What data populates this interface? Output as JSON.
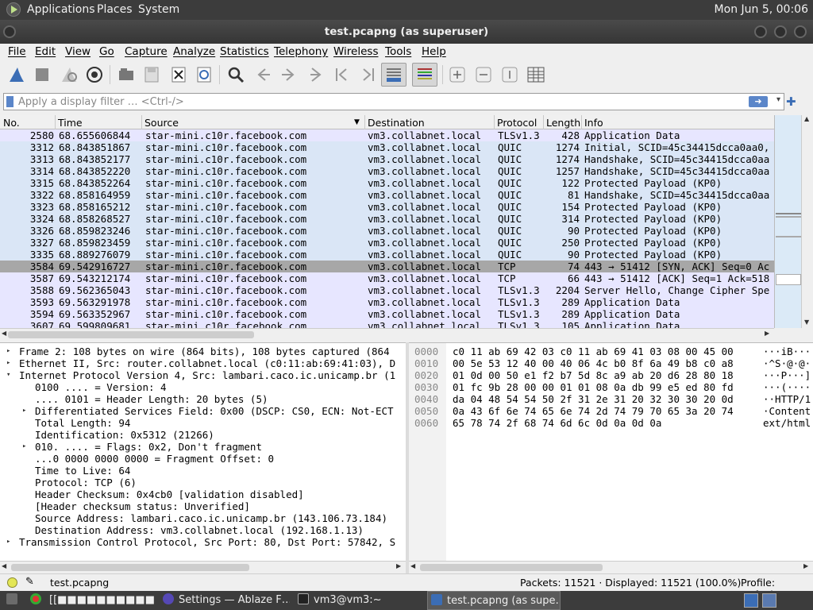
{
  "top_panel": {
    "menus": [
      "Applications",
      "Places",
      "System"
    ],
    "clock": "Mon Jun  5, 00:06"
  },
  "window": {
    "title": "test.pcapng (as superuser)"
  },
  "menubar": [
    "File",
    "Edit",
    "View",
    "Go",
    "Capture",
    "Analyze",
    "Statistics",
    "Telephony",
    "Wireless",
    "Tools",
    "Help"
  ],
  "filter": {
    "placeholder": "Apply a display filter … <Ctrl-/>"
  },
  "packet_list": {
    "columns": [
      "No.",
      "Time",
      "Source",
      "Destination",
      "Protocol",
      "Length",
      "Info"
    ],
    "rows": [
      [
        "2580",
        "68.655606844",
        "star-mini.c10r.facebook.com",
        "vm3.collabnet.local",
        "TLSv1.3",
        "428",
        "Application Data"
      ],
      [
        "3312",
        "68.843851867",
        "star-mini.c10r.facebook.com",
        "vm3.collabnet.local",
        "QUIC",
        "1274",
        "Initial, SCID=45c34415dcca0aa0,"
      ],
      [
        "3313",
        "68.843852177",
        "star-mini.c10r.facebook.com",
        "vm3.collabnet.local",
        "QUIC",
        "1274",
        "Handshake, SCID=45c34415dcca0aa"
      ],
      [
        "3314",
        "68.843852220",
        "star-mini.c10r.facebook.com",
        "vm3.collabnet.local",
        "QUIC",
        "1257",
        "Handshake, SCID=45c34415dcca0aa"
      ],
      [
        "3315",
        "68.843852264",
        "star-mini.c10r.facebook.com",
        "vm3.collabnet.local",
        "QUIC",
        "122",
        "Protected Payload (KP0)"
      ],
      [
        "3322",
        "68.858164959",
        "star-mini.c10r.facebook.com",
        "vm3.collabnet.local",
        "QUIC",
        "81",
        "Handshake, SCID=45c34415dcca0aa"
      ],
      [
        "3323",
        "68.858165212",
        "star-mini.c10r.facebook.com",
        "vm3.collabnet.local",
        "QUIC",
        "154",
        "Protected Payload (KP0)"
      ],
      [
        "3324",
        "68.858268527",
        "star-mini.c10r.facebook.com",
        "vm3.collabnet.local",
        "QUIC",
        "314",
        "Protected Payload (KP0)"
      ],
      [
        "3326",
        "68.859823246",
        "star-mini.c10r.facebook.com",
        "vm3.collabnet.local",
        "QUIC",
        "90",
        "Protected Payload (KP0)"
      ],
      [
        "3327",
        "68.859823459",
        "star-mini.c10r.facebook.com",
        "vm3.collabnet.local",
        "QUIC",
        "250",
        "Protected Payload (KP0)"
      ],
      [
        "3335",
        "68.889276079",
        "star-mini.c10r.facebook.com",
        "vm3.collabnet.local",
        "QUIC",
        "90",
        "Protected Payload (KP0)"
      ],
      [
        "3584",
        "69.542916727",
        "star-mini.c10r.facebook.com",
        "vm3.collabnet.local",
        "TCP",
        "74",
        "443 → 51412 [SYN, ACK] Seq=0 Ac"
      ],
      [
        "3587",
        "69.543212174",
        "star-mini.c10r.facebook.com",
        "vm3.collabnet.local",
        "TCP",
        "66",
        "443 → 51412 [ACK] Seq=1 Ack=518"
      ],
      [
        "3588",
        "69.562365043",
        "star-mini.c10r.facebook.com",
        "vm3.collabnet.local",
        "TLSv1.3",
        "2204",
        "Server Hello, Change Cipher Spe"
      ],
      [
        "3593",
        "69.563291978",
        "star-mini.c10r.facebook.com",
        "vm3.collabnet.local",
        "TLSv1.3",
        "289",
        "Application Data"
      ],
      [
        "3594",
        "69.563352967",
        "star-mini.c10r.facebook.com",
        "vm3.collabnet.local",
        "TLSv1.3",
        "289",
        "Application Data"
      ],
      [
        "3607",
        "69.599809681",
        "star-mini.c10r.facebook.com",
        "vm3.collabnet.local",
        "TLSv1.3",
        "105",
        "Application Data"
      ]
    ],
    "row_colors": {
      "tls": "#e7e6ff",
      "quic": "#dae6f6",
      "tcp": "#e7e6ff",
      "selected": "#a7a7a7"
    }
  },
  "details": [
    {
      "text": "Frame 2: 108 bytes on wire (864 bits), 108 bytes captured (864",
      "toggle": "▸",
      "indent": 0
    },
    {
      "text": "Ethernet II, Src: router.collabnet.local (c0:11:ab:69:41:03), D",
      "toggle": "▸",
      "indent": 0
    },
    {
      "text": "Internet Protocol Version 4, Src: lambari.caco.ic.unicamp.br (1",
      "toggle": "▾",
      "indent": 0
    },
    {
      "text": "0100 .... = Version: 4",
      "toggle": "",
      "indent": 1
    },
    {
      "text": ".... 0101 = Header Length: 20 bytes (5)",
      "toggle": "",
      "indent": 1
    },
    {
      "text": "Differentiated Services Field: 0x00 (DSCP: CS0, ECN: Not-ECT",
      "toggle": "▸",
      "indent": 1
    },
    {
      "text": "Total Length: 94",
      "toggle": "",
      "indent": 1
    },
    {
      "text": "Identification: 0x5312 (21266)",
      "toggle": "",
      "indent": 1
    },
    {
      "text": "010. .... = Flags: 0x2, Don't fragment",
      "toggle": "▸",
      "indent": 1
    },
    {
      "text": "...0 0000 0000 0000 = Fragment Offset: 0",
      "toggle": "",
      "indent": 1
    },
    {
      "text": "Time to Live: 64",
      "toggle": "",
      "indent": 1
    },
    {
      "text": "Protocol: TCP (6)",
      "toggle": "",
      "indent": 1
    },
    {
      "text": "Header Checksum: 0x4cb0 [validation disabled]",
      "toggle": "",
      "indent": 1
    },
    {
      "text": "[Header checksum status: Unverified]",
      "toggle": "",
      "indent": 1
    },
    {
      "text": "Source Address: lambari.caco.ic.unicamp.br (143.106.73.184)",
      "toggle": "",
      "indent": 1
    },
    {
      "text": "Destination Address: vm3.collabnet.local (192.168.1.13)",
      "toggle": "",
      "indent": 1
    },
    {
      "text": "Transmission Control Protocol, Src Port: 80, Dst Port: 57842, S",
      "toggle": "▸",
      "indent": 0
    }
  ],
  "bytes": [
    {
      "offset": "0000",
      "hex": "c0 11 ab 69 42 03 c0 11  ab 69 41 03 08 00 45 00",
      "ascii": "···iB···"
    },
    {
      "offset": "0010",
      "hex": "00 5e 53 12 40 00 40 06  4c b0 8f 6a 49 b8 c0 a8",
      "ascii": "·^S·@·@·"
    },
    {
      "offset": "0020",
      "hex": "01 0d 00 50 e1 f2 b7 5d  8c a9 ab 20 d6 28 80 18",
      "ascii": "···P···]"
    },
    {
      "offset": "0030",
      "hex": "01 fc 9b 28 00 00 01 01  08 0a db 99 e5 ed 80 fd",
      "ascii": "···(····"
    },
    {
      "offset": "0040",
      "hex": "da 04 48 54 54 50 2f 31  2e 31 20 32 30 30 20 0d",
      "ascii": "··HTTP/1"
    },
    {
      "offset": "0050",
      "hex": "0a 43 6f 6e 74 65 6e 74  2d 74 79 70 65 3a 20 74",
      "ascii": "·Content"
    },
    {
      "offset": "0060",
      "hex": "65 78 74 2f 68 74 6d 6c  0d 0a 0d 0a",
      "ascii": "ext/html"
    }
  ],
  "status": {
    "file": "test.pcapng",
    "packets": "Packets: 11521 · Displayed: 11521 (100.0%)",
    "profile": "Profile: Default"
  },
  "taskbar": {
    "tasks": [
      "[[■■■■■■■■■■■M…",
      "Settings — Ablaze F…",
      "vm3@vm3:~",
      "test.pcapng (as supe…"
    ]
  }
}
